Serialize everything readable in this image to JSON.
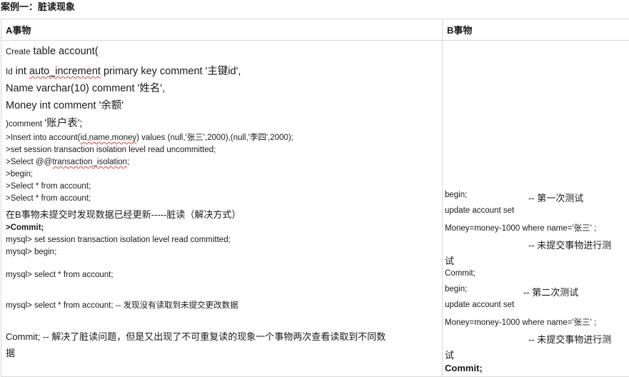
{
  "page_title": "案例一：脏读现象",
  "table": {
    "col_a_header": "A事物",
    "col_b_header": "B事物"
  },
  "a_lines": [
    "Create table account(",
    "Id  int  auto_increment primary key comment '主键id',",
    "Name varchar(10) comment '姓名',",
    "Money int comment '余额'",
    ")comment '账户表';",
    ">Insert into account(id,name,money) values (null,'张三',2000),(null,'李四',2000);",
    ">set session transaction isolation level read uncommitted;",
    ">Select @@transaction_isolation;",
    ">begin;",
    ">Select * from account;",
    ">Select * from account;",
    "在B事物未提交时发现数据已经更新-----脏读（解决方式）",
    ">Commit;",
    "mysql> set session  transaction isolation level read committed;",
    "mysql> begin;",
    "mysql> select * from account;",
    "mysql> select * from account; -- 发现没有读取到未提交更改数据",
    "Commit;    --     解决了脏读问题，但是又出现了不可重复读的现象一个事物两次查看读取到不同数",
    "据"
  ],
  "b_lines": [
    "begin;",
    "-- 第一次测试",
    "update account set",
    "Money=money-1000 where name='张三' ;",
    "-- 未提交事物进行测",
    "试",
    "Commit;",
    "begin;",
    "-- 第二次测试",
    "update account set",
    "Money=money-1000 where name='张三' ;",
    "-- 未提交事物进行测",
    "试",
    "Commit;"
  ]
}
